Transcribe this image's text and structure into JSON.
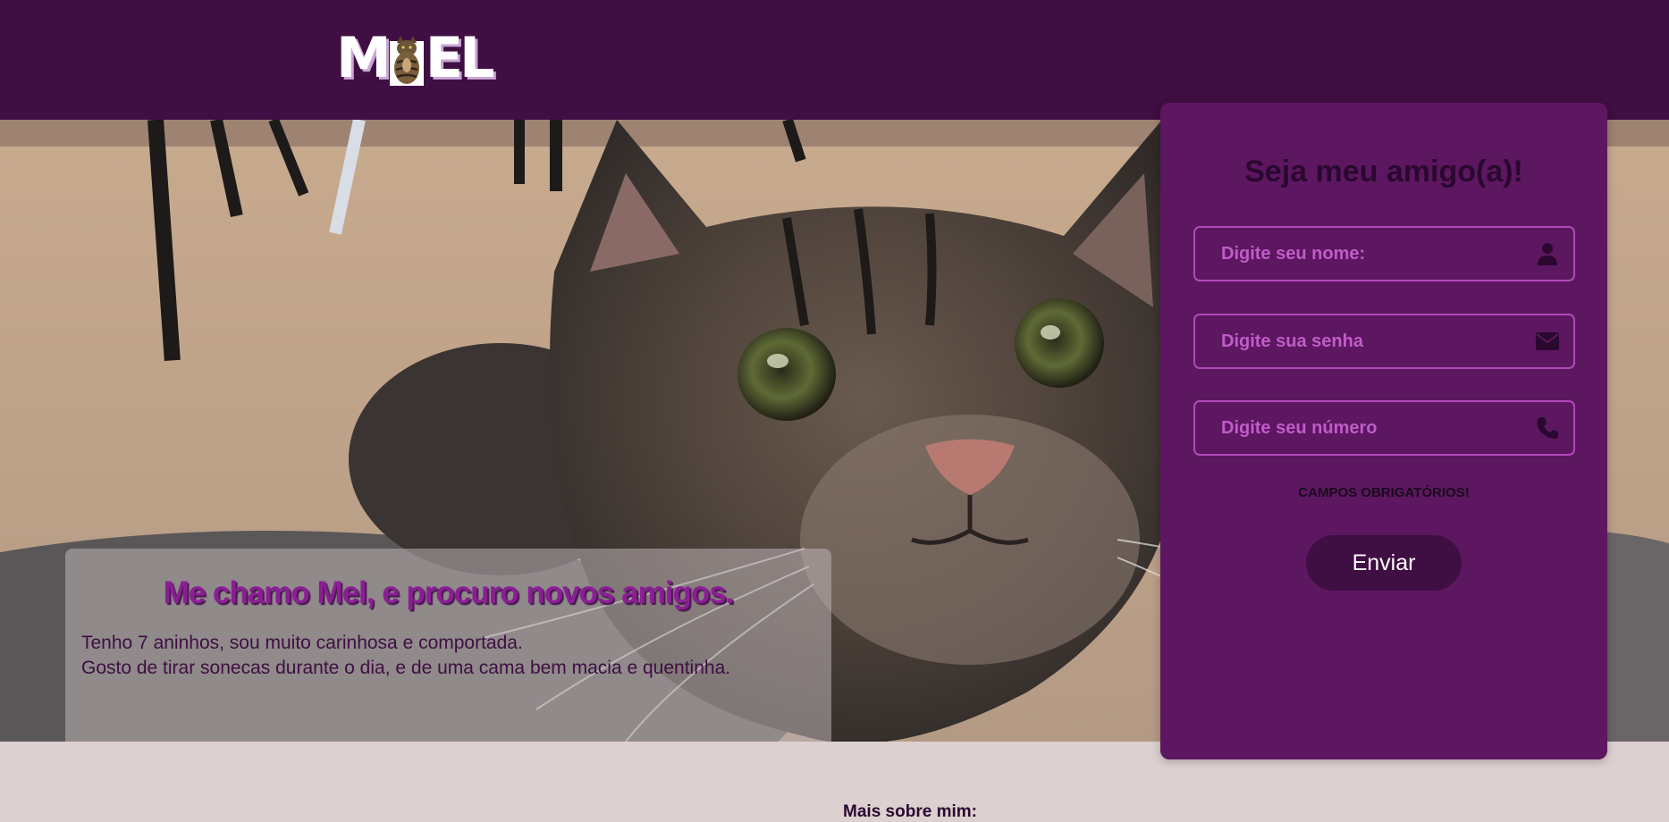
{
  "header": {
    "logo_text_left": "M",
    "logo_text_right": "EL",
    "logo_icon": "cat-icon",
    "background": "#3f0e42"
  },
  "hero": {
    "title": "Me chamo Mel, e procuro novos amigos.",
    "line1": "Tenho 7 aninhos, sou muito carinhosa e comportada.",
    "line2": "Gosto de tirar sonecas durante o dia, e de uma cama bem macia e quentinha."
  },
  "form": {
    "title": "Seja meu amigo(a)!",
    "fields": [
      {
        "placeholder": "Digite seu nome:",
        "icon": "user-icon"
      },
      {
        "placeholder": "Digite sua senha",
        "icon": "envelope-icon"
      },
      {
        "placeholder": "Digite seu número",
        "icon": "phone-icon"
      }
    ],
    "required_note": "CAMPOS OBRIGATÓRIOS!",
    "submit_label": "Enviar",
    "card_color": "#5c1760",
    "accent": "#b04ab8"
  },
  "footer": {
    "more_label": "Mais sobre mim:"
  }
}
